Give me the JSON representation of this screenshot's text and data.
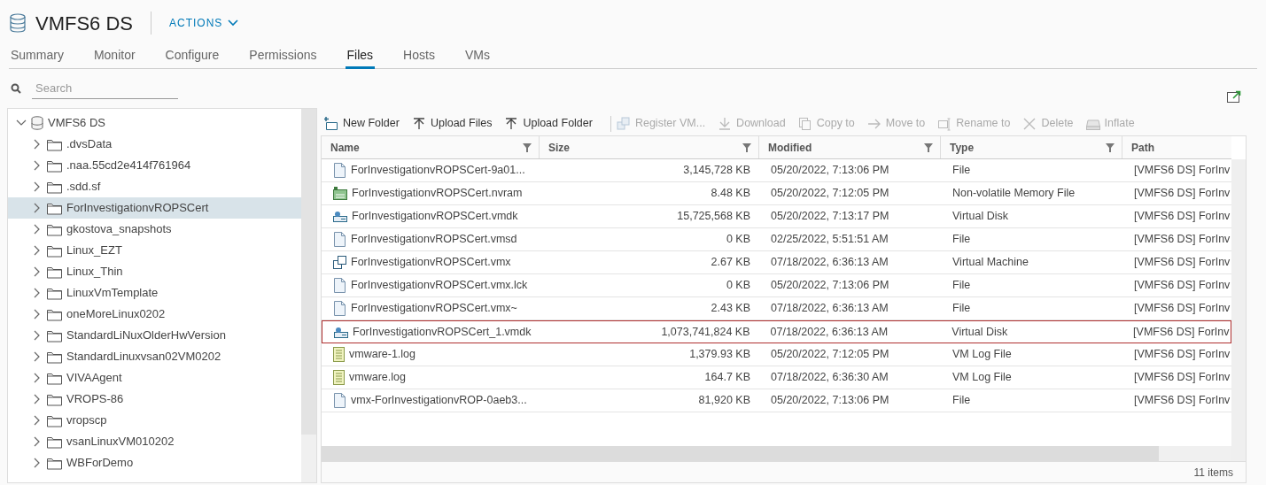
{
  "header": {
    "title": "VMFS6 DS",
    "actions": "ACTIONS"
  },
  "tabs": [
    {
      "label": "Summary",
      "selected": false
    },
    {
      "label": "Monitor",
      "selected": false
    },
    {
      "label": "Configure",
      "selected": false
    },
    {
      "label": "Permissions",
      "selected": false
    },
    {
      "label": "Files",
      "selected": true
    },
    {
      "label": "Hosts",
      "selected": false
    },
    {
      "label": "VMs",
      "selected": false
    }
  ],
  "search": {
    "placeholder": "Search"
  },
  "tree": {
    "label": "VMFS6 DS",
    "expanded": true,
    "children": [
      {
        "label": ".dvsData",
        "expanded": false,
        "selected": false
      },
      {
        "label": ".naa.55cd2e414f761964",
        "expanded": false,
        "selected": false
      },
      {
        "label": ".sdd.sf",
        "expanded": false,
        "selected": false
      },
      {
        "label": "ForInvestigationvROPSCert",
        "expanded": false,
        "selected": true
      },
      {
        "label": "gkostova_snapshots",
        "expanded": false,
        "selected": false
      },
      {
        "label": "Linux_EZT",
        "expanded": false,
        "selected": false
      },
      {
        "label": "Linux_Thin",
        "expanded": false,
        "selected": false
      },
      {
        "label": "LinuxVmTemplate",
        "expanded": false,
        "selected": false
      },
      {
        "label": "oneMoreLinux0202",
        "expanded": false,
        "selected": false
      },
      {
        "label": "StandardLiNuxOlderHwVersion",
        "expanded": false,
        "selected": false
      },
      {
        "label": "StandardLinuxvsan02VM0202",
        "expanded": false,
        "selected": false
      },
      {
        "label": "VIVAAgent",
        "expanded": false,
        "selected": false
      },
      {
        "label": "VROPS-86",
        "expanded": false,
        "selected": false
      },
      {
        "label": "vropscp",
        "expanded": false,
        "selected": false
      },
      {
        "label": "vsanLinuxVM010202",
        "expanded": false,
        "selected": false
      },
      {
        "label": "WBForDemo",
        "expanded": false,
        "selected": false
      }
    ]
  },
  "toolbar": [
    {
      "kind": "new-folder",
      "label": "New Folder",
      "disabled": false
    },
    {
      "kind": "upload",
      "label": "Upload Files",
      "disabled": false
    },
    {
      "kind": "upload",
      "label": "Upload Folder",
      "disabled": false
    },
    {
      "kind": "register",
      "label": "Register VM...",
      "disabled": true
    },
    {
      "kind": "download",
      "label": "Download",
      "disabled": true
    },
    {
      "kind": "copy",
      "label": "Copy to",
      "disabled": true
    },
    {
      "kind": "move",
      "label": "Move to",
      "disabled": true
    },
    {
      "kind": "rename",
      "label": "Rename to",
      "disabled": true
    },
    {
      "kind": "delete",
      "label": "Delete",
      "disabled": true
    },
    {
      "kind": "inflate",
      "label": "Inflate",
      "disabled": true
    }
  ],
  "table": {
    "columns": [
      {
        "label": "Name",
        "filter": true
      },
      {
        "label": "Size",
        "filter": true
      },
      {
        "label": "Modified",
        "filter": true
      },
      {
        "label": "Type",
        "filter": true
      },
      {
        "label": "Path",
        "filter": false
      }
    ],
    "rows": [
      {
        "kind": "file",
        "name": "ForInvestigationvROPSCert-9a01...",
        "size": "3,145,728 KB",
        "modified": "05/20/2022, 7:13:06 PM",
        "type": "File",
        "path": "[VMFS6 DS] ForInv",
        "outlined": false
      },
      {
        "kind": "nvram",
        "name": "ForInvestigationvROPSCert.nvram",
        "size": "8.48 KB",
        "modified": "05/20/2022, 7:12:05 PM",
        "type": "Non-volatile Memory File",
        "path": "[VMFS6 DS] ForInv",
        "outlined": false
      },
      {
        "kind": "disk",
        "name": "ForInvestigationvROPSCert.vmdk",
        "size": "15,725,568 KB",
        "modified": "05/20/2022, 7:13:17 PM",
        "type": "Virtual Disk",
        "path": "[VMFS6 DS] ForInv",
        "outlined": false
      },
      {
        "kind": "file",
        "name": "ForInvestigationvROPSCert.vmsd",
        "size": "0 KB",
        "modified": "02/25/2022, 5:51:51 AM",
        "type": "File",
        "path": "[VMFS6 DS] ForInv",
        "outlined": false
      },
      {
        "kind": "vm",
        "name": "ForInvestigationvROPSCert.vmx",
        "size": "2.67 KB",
        "modified": "07/18/2022, 6:36:13 AM",
        "type": "Virtual Machine",
        "path": "[VMFS6 DS] ForInv",
        "outlined": false
      },
      {
        "kind": "file",
        "name": "ForInvestigationvROPSCert.vmx.lck",
        "size": "0 KB",
        "modified": "05/20/2022, 7:13:06 PM",
        "type": "File",
        "path": "[VMFS6 DS] ForInv",
        "outlined": false
      },
      {
        "kind": "file",
        "name": "ForInvestigationvROPSCert.vmx~",
        "size": "2.43 KB",
        "modified": "07/18/2022, 6:36:13 AM",
        "type": "File",
        "path": "[VMFS6 DS] ForInv",
        "outlined": false
      },
      {
        "kind": "disk",
        "name": "ForInvestigationvROPSCert_1.vmdk",
        "size": "1,073,741,824 KB",
        "modified": "07/18/2022, 6:36:13 AM",
        "type": "Virtual Disk",
        "path": "[VMFS6 DS] ForInv",
        "outlined": true
      },
      {
        "kind": "log",
        "name": "vmware-1.log",
        "size": "1,379.93 KB",
        "modified": "05/20/2022, 7:12:05 PM",
        "type": "VM Log File",
        "path": "[VMFS6 DS] ForInv",
        "outlined": false
      },
      {
        "kind": "log",
        "name": "vmware.log",
        "size": "164.7 KB",
        "modified": "07/18/2022, 6:36:30 AM",
        "type": "VM Log File",
        "path": "[VMFS6 DS] ForInv",
        "outlined": false
      },
      {
        "kind": "file",
        "name": "vmx-ForInvestigationvROP-0aeb3...",
        "size": "81,920 KB",
        "modified": "05/20/2022, 7:13:06 PM",
        "type": "File",
        "path": "[VMFS6 DS] ForInv",
        "outlined": false
      }
    ]
  },
  "footer": {
    "count": "11 items"
  }
}
